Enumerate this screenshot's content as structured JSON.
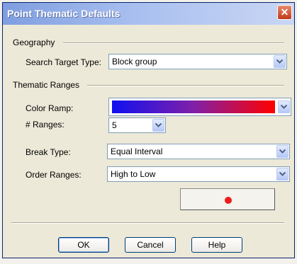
{
  "window": {
    "title": "Point Thematic Defaults",
    "close_glyph": "✕"
  },
  "geography": {
    "section_label": "Geography",
    "search_target_type_label": "Search Target Type:",
    "search_target_type_value": "Block group"
  },
  "thematic_ranges": {
    "section_label": "Thematic Ranges",
    "color_ramp_label": "Color Ramp:",
    "color_ramp": {
      "start_color": "#1010f0",
      "mid_color": "#8020a8",
      "end_color": "#ff0000"
    },
    "num_ranges_label": "# Ranges:",
    "num_ranges_value": "5",
    "break_type_label": "Break Type:",
    "break_type_value": "Equal Interval",
    "order_ranges_label": "Order Ranges:",
    "order_ranges_value": "High to Low",
    "symbol": {
      "icon": "red-dot-icon",
      "color": "#ee1c1c"
    }
  },
  "buttons": {
    "ok": "OK",
    "cancel": "Cancel",
    "help": "Help"
  }
}
